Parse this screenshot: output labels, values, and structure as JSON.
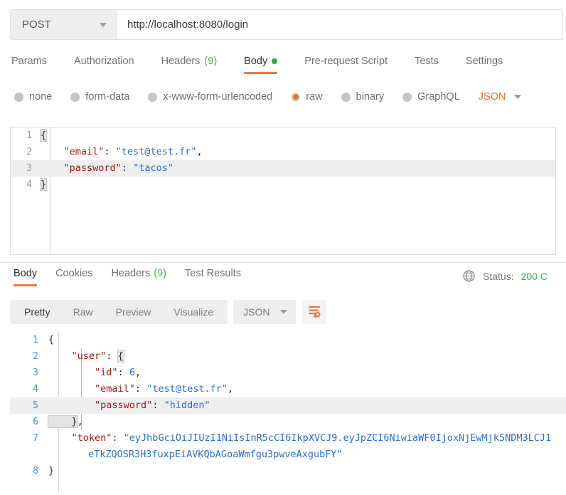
{
  "request": {
    "method": "POST",
    "url": "http://localhost:8080/login",
    "tabs": [
      {
        "label": "Params",
        "active": false,
        "count": null,
        "dot": false
      },
      {
        "label": "Authorization",
        "active": false,
        "count": null,
        "dot": false
      },
      {
        "label": "Headers",
        "active": false,
        "count": "(9)",
        "dot": false
      },
      {
        "label": "Body",
        "active": true,
        "count": null,
        "dot": true
      },
      {
        "label": "Pre-request Script",
        "active": false,
        "count": null,
        "dot": false
      },
      {
        "label": "Tests",
        "active": false,
        "count": null,
        "dot": false
      },
      {
        "label": "Settings",
        "active": false,
        "count": null,
        "dot": false
      }
    ],
    "body_types": [
      {
        "label": "none",
        "selected": false
      },
      {
        "label": "form-data",
        "selected": false
      },
      {
        "label": "x-www-form-urlencoded",
        "selected": false
      },
      {
        "label": "raw",
        "selected": true
      },
      {
        "label": "binary",
        "selected": false
      },
      {
        "label": "GraphQL",
        "selected": false
      }
    ],
    "body_format": "JSON",
    "body_lines": [
      {
        "n": "1",
        "highlighted": false,
        "indent": 0,
        "segments": [
          {
            "t": "{",
            "c": "punct-brace"
          }
        ]
      },
      {
        "n": "2",
        "highlighted": false,
        "indent": 0,
        "segments": [
          {
            "t": "    \"email\"",
            "c": "key"
          },
          {
            "t": ": ",
            "c": "punct"
          },
          {
            "t": "\"test@test.fr\"",
            "c": "str"
          },
          {
            "t": ",",
            "c": "punct"
          }
        ]
      },
      {
        "n": "3",
        "highlighted": true,
        "indent": 0,
        "segments": [
          {
            "t": "    \"password\"",
            "c": "key"
          },
          {
            "t": ": ",
            "c": "punct"
          },
          {
            "t": "\"tacos\"",
            "c": "str"
          }
        ]
      },
      {
        "n": "4",
        "highlighted": false,
        "indent": 0,
        "segments": [
          {
            "t": "}",
            "c": "punct-brace"
          }
        ]
      }
    ]
  },
  "response": {
    "tabs": [
      {
        "label": "Body",
        "active": true,
        "count": null
      },
      {
        "label": "Cookies",
        "active": false,
        "count": null
      },
      {
        "label": "Headers",
        "active": false,
        "count": "(9)"
      },
      {
        "label": "Test Results",
        "active": false,
        "count": null
      }
    ],
    "status_label": "Status:",
    "status_value": "200 C",
    "view_modes": [
      {
        "label": "Pretty",
        "active": true
      },
      {
        "label": "Raw",
        "active": false
      },
      {
        "label": "Preview",
        "active": false
      },
      {
        "label": "Visualize",
        "active": false
      }
    ],
    "format": "JSON",
    "wrap_button_title": "Wrap lines",
    "body_lines": [
      {
        "n": "1",
        "highlighted": false,
        "segments": [
          {
            "t": "{",
            "c": "punct"
          }
        ]
      },
      {
        "n": "2",
        "highlighted": false,
        "segments": [
          {
            "t": "    \"user\"",
            "c": "key"
          },
          {
            "t": ": ",
            "c": "punct"
          },
          {
            "t": "{",
            "c": "punct-brace"
          }
        ]
      },
      {
        "n": "3",
        "highlighted": false,
        "segments": [
          {
            "t": "        \"id\"",
            "c": "key"
          },
          {
            "t": ": ",
            "c": "punct"
          },
          {
            "t": "6",
            "c": "num"
          },
          {
            "t": ",",
            "c": "punct"
          }
        ]
      },
      {
        "n": "4",
        "highlighted": false,
        "segments": [
          {
            "t": "        \"email\"",
            "c": "key"
          },
          {
            "t": ": ",
            "c": "punct"
          },
          {
            "t": "\"test@test.fr\"",
            "c": "str"
          },
          {
            "t": ",",
            "c": "punct"
          }
        ]
      },
      {
        "n": "5",
        "highlighted": true,
        "segments": [
          {
            "t": "        \"password\"",
            "c": "key"
          },
          {
            "t": ": ",
            "c": "punct"
          },
          {
            "t": "\"hidden\"",
            "c": "str"
          }
        ]
      },
      {
        "n": "6",
        "highlighted": false,
        "segments": [
          {
            "t": "    }",
            "c": "punct-brace"
          },
          {
            "t": ",",
            "c": "punct"
          }
        ]
      },
      {
        "n": "7",
        "highlighted": false,
        "segments": [
          {
            "t": "    \"token\"",
            "c": "key"
          },
          {
            "t": ": ",
            "c": "punct"
          },
          {
            "t": "\"eyJhbGciOiJIUzI1NiIsInR5cCI6IkpXVCJ9.eyJpZCI6NiwiaWF0IjoxNjEwMjk5NDM3LCJ1",
            "c": "str"
          }
        ]
      },
      {
        "n": "",
        "highlighted": false,
        "continuation": true,
        "segments": [
          {
            "t": "eTkZQOSR3H3fuxpEiAVKQbAGoaWmfgu3pwveAxgubFY\"",
            "c": "str"
          }
        ]
      },
      {
        "n": "8",
        "highlighted": false,
        "segments": [
          {
            "t": "}",
            "c": "punct"
          }
        ]
      }
    ]
  },
  "colors": {
    "accent": "#ec7b39",
    "json_key": "#a31515",
    "json_string": "#2a6fc9",
    "status_ok": "#3ba94c",
    "badge_count": "#4caf50",
    "body_dot": "#2eaa3f"
  }
}
